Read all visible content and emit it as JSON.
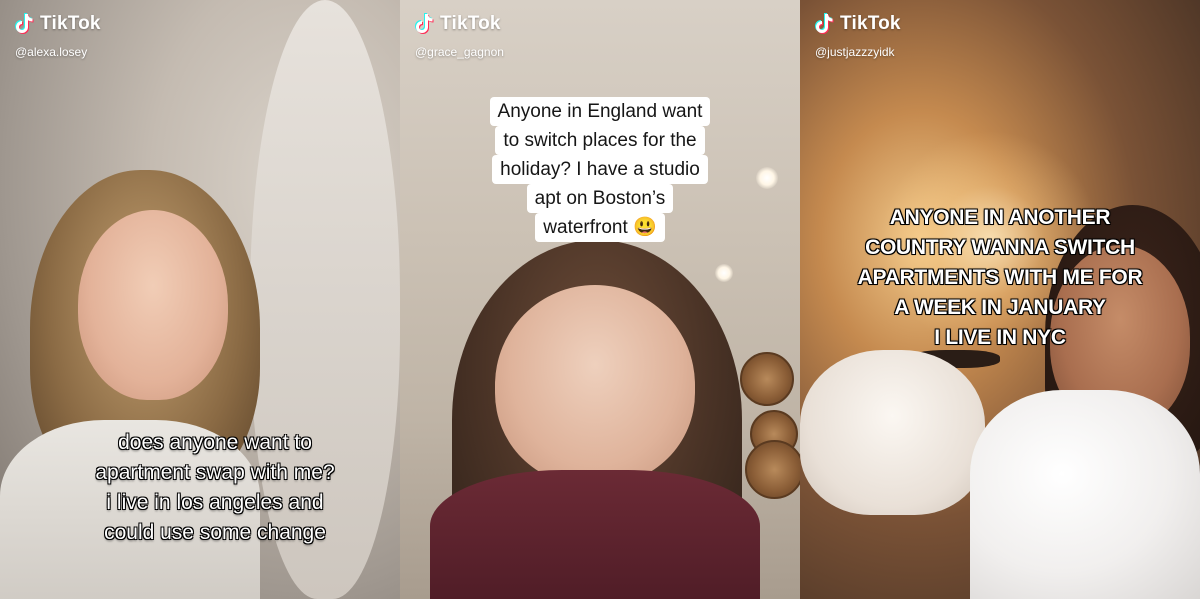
{
  "panels": [
    {
      "brand": "TikTok",
      "handle": "@alexa.losey",
      "caption_lines": [
        "does anyone want to",
        "apartment swap with me?",
        "i live in los angeles and",
        "could use some change"
      ]
    },
    {
      "brand": "TikTok",
      "handle": "@grace_gagnon",
      "caption_lines": [
        "Anyone in England want",
        "to switch places for the",
        "holiday? I have a studio",
        "apt on Boston’s",
        "waterfront 😃"
      ]
    },
    {
      "brand": "TikTok",
      "handle": "@justjazzzyidk",
      "caption_lines": [
        "ANYONE IN ANOTHER",
        "COUNTRY WANNA SWITCH",
        "APARTMENTS WITH ME FOR",
        "A WEEK IN JANUARY",
        "I LIVE IN NYC"
      ]
    }
  ],
  "icons": {
    "brand_logo": "tiktok-note-icon"
  },
  "colors": {
    "tiktok_cyan": "#25F4EE",
    "tiktok_red": "#FE2C55",
    "caption_box": "#FFFFFF"
  }
}
